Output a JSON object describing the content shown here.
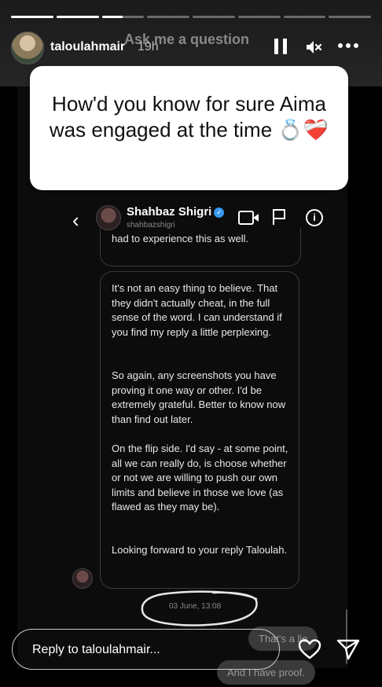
{
  "story": {
    "progress": [
      1,
      1,
      0.5,
      0,
      0,
      0,
      0,
      0
    ],
    "username": "taloulahmair",
    "time": "19h",
    "overlay_header": "Ask me a question"
  },
  "question_card": {
    "text": "How'd you know for sure Aima was engaged at the time 💍❤️‍🩹"
  },
  "chat": {
    "back_glyph": "‹",
    "name": "Shahbaz Shigri",
    "verified_glyph": "✓",
    "handle": "shahbazshigri",
    "info_glyph": "i",
    "top_bubble_text": "had to experience this as well.",
    "paragraphs": [
      "It's not an easy thing to believe. That they didn't actually cheat, in the full sense of the word. I can understand if you find my reply a little perplexing.",
      "So again, any screenshots you have proving it one way or other. I'd be extremely grateful. Better to know now than find out later.",
      "On the flip side. I'd say - at some point, all we can really do, is choose whether or not we are willing to push our own limits and believe in those we love (as flawed as they may be).",
      "Looking forward to your reply Taloulah."
    ],
    "date": "03 June, 13:08",
    "partial_messages": [
      "That's a lie",
      "And I have proof."
    ]
  },
  "footer": {
    "reply_placeholder": "Reply to taloulahmair...",
    "icons": [
      "heart-icon",
      "send-icon"
    ]
  }
}
